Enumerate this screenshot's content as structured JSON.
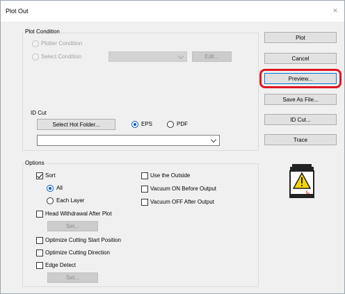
{
  "window": {
    "title": "Plot Out",
    "close_glyph": "×"
  },
  "plot_condition": {
    "legend": "Plot Condition",
    "plotter_condition_label": "Plotter Condition",
    "select_condition_label": "Select Condition",
    "select_condition_value": "",
    "edit_label": "Edit..."
  },
  "id_cut": {
    "label": "ID Cut",
    "select_hot_folder_label": "Select Hot Folder...",
    "eps_label": "EPS",
    "pdf_label": "PDF",
    "selected_format": "EPS",
    "hot_folder_value": ""
  },
  "options": {
    "legend": "Options",
    "sort_label": "Sort",
    "sort_checked": true,
    "all_label": "All",
    "each_layer_label": "Each Layer",
    "sort_mode": "All",
    "head_withdrawal_label": "Head Withdrawal After Plot",
    "head_withdrawal_set_label": "Set...",
    "optimize_start_label": "Optimize Cutting Start Position",
    "optimize_direction_label": "Optimize Cutting Direction",
    "edge_detect_label": "Edge Detect",
    "edge_detect_set_label": "Set...",
    "use_outside_label": "Use the Outside",
    "vacuum_on_label": "Vacuum ON Before Output",
    "vacuum_off_label": "Vacuum OFF After Output"
  },
  "buttons": {
    "plot": "Plot",
    "cancel": "Cancel",
    "preview": "Preview...",
    "save_as_file": "Save As File...",
    "id_cut": "ID Cut...",
    "trace": "Trace"
  },
  "colors": {
    "highlight": "#e0161f",
    "warning_yellow": "#f5d400",
    "accent": "#0055cc"
  }
}
